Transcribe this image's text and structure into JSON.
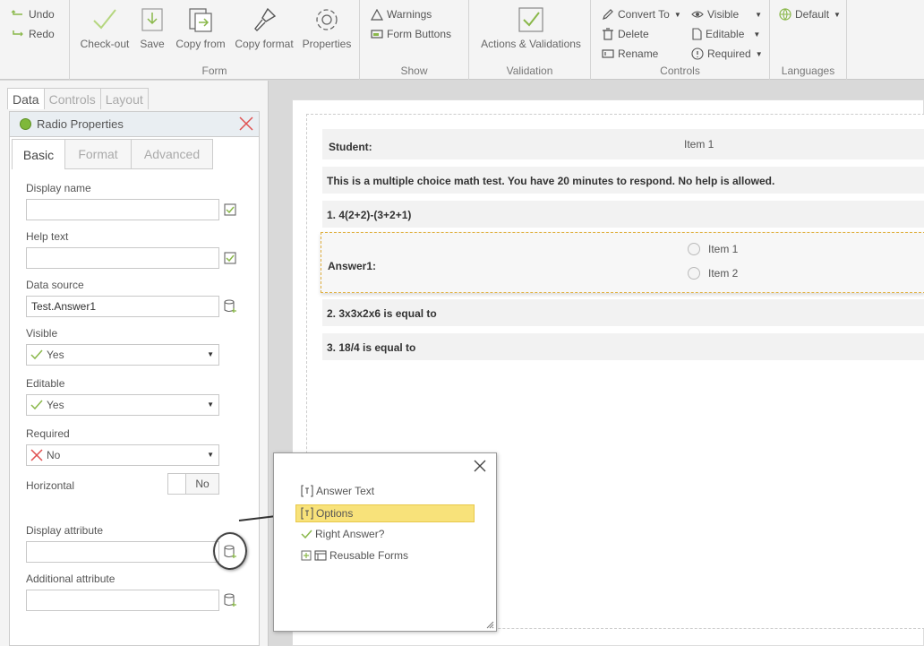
{
  "ribbon": {
    "undo": "Undo",
    "redo": "Redo",
    "form": {
      "label": "Form",
      "checkout": "Check-out",
      "save": "Save",
      "copy_from": "Copy from",
      "copy_format": "Copy format",
      "properties": "Properties"
    },
    "show": {
      "label": "Show",
      "warnings": "Warnings",
      "form_buttons": "Form Buttons"
    },
    "validation": {
      "label": "Validation",
      "actions": "Actions & Validations"
    },
    "controls": {
      "label": "Controls",
      "convert_to": "Convert To",
      "delete": "Delete",
      "rename": "Rename",
      "visible": "Visible",
      "editable": "Editable",
      "required": "Required"
    },
    "languages": {
      "label": "Languages",
      "default": "Default"
    }
  },
  "left": {
    "tabs": [
      "Data",
      "Controls",
      "Layout"
    ],
    "panel_title": "Radio Properties",
    "subtabs": [
      "Basic",
      "Format",
      "Advanced"
    ],
    "fields": {
      "display_name_label": "Display name",
      "display_name_value": "",
      "help_text_label": "Help text",
      "help_text_value": "",
      "data_source_label": "Data source",
      "data_source_value": "Test.Answer1",
      "visible_label": "Visible",
      "visible_value": "Yes",
      "editable_label": "Editable",
      "editable_value": "Yes",
      "required_label": "Required",
      "required_value": "No",
      "horizontal_label": "Horizontal",
      "horizontal_value": "No",
      "display_attr_label": "Display attribute",
      "display_attr_value": "",
      "additional_attr_label": "Additional attribute",
      "additional_attr_value": ""
    }
  },
  "canvas": {
    "student_label": "Student:",
    "student_item": "Item 1",
    "intro": "This is a multiple choice math test. You have 20 minutes to respond. No help is allowed.",
    "q1": "1. 4(2+2)-(3+2+1)",
    "answer1_label": "Answer1:",
    "answer_items": [
      "Item 1",
      "Item 2"
    ],
    "q2": "2. 3x3x2x6 is equal to",
    "q3": "3. 18/4 is equal to"
  },
  "popup": {
    "items": [
      "Answer Text",
      "Options",
      "Right Answer?",
      "Reusable Forms"
    ]
  },
  "colors": {
    "accent": "#7fb83a",
    "highlight": "#f8e27a",
    "close": "#e05050"
  }
}
